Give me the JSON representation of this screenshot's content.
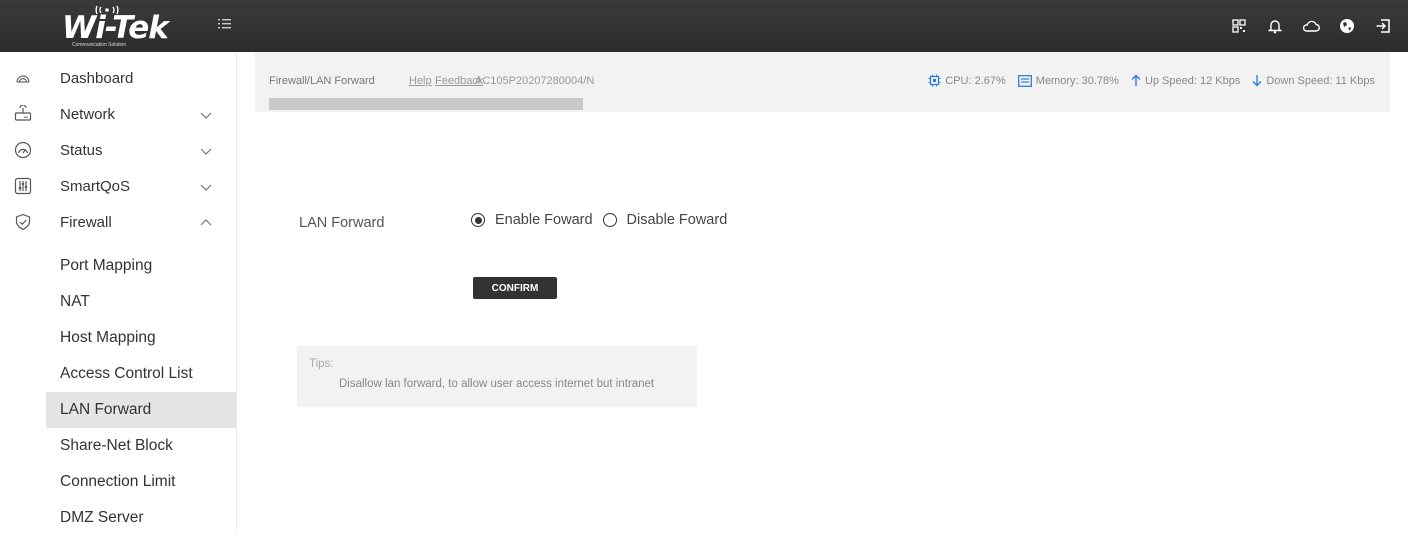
{
  "brand": {
    "logo": "Wi-Tek",
    "tagline": "Communication Solution"
  },
  "topbar": {
    "icons": [
      "qr-code-icon",
      "bell-icon",
      "cloud-icon",
      "globe-icon",
      "logout-icon"
    ]
  },
  "sidebar": {
    "items": [
      {
        "label": "Dashboard",
        "icon": "dashboard-icon"
      },
      {
        "label": "Network",
        "icon": "router-icon",
        "expanded": false
      },
      {
        "label": "Status",
        "icon": "gauge-icon",
        "expanded": false
      },
      {
        "label": "SmartQoS",
        "icon": "sliders-icon",
        "expanded": false
      },
      {
        "label": "Firewall",
        "icon": "shield-icon",
        "expanded": true
      }
    ],
    "firewall_sub": [
      {
        "label": "Port Mapping"
      },
      {
        "label": "NAT"
      },
      {
        "label": "Host Mapping"
      },
      {
        "label": "Access Control List"
      },
      {
        "label": "LAN Forward",
        "active": true
      },
      {
        "label": "Share-Net Block"
      },
      {
        "label": "Connection Limit"
      },
      {
        "label": "DMZ Server"
      }
    ]
  },
  "header": {
    "breadcrumb": "Firewall/LAN Forward",
    "help": "Help",
    "feedback": "Feedback",
    "serial": "AC105P20207280004/N",
    "cpu": "CPU: 2.67%",
    "memory": "Memory: 30.78%",
    "up_speed": "Up Speed: 12 Kbps",
    "down_speed": "Down Speed: 11 Kbps"
  },
  "form": {
    "label": "LAN Forward",
    "enable": "Enable Foward",
    "disable": "Disable Foward",
    "selected": "enable",
    "confirm": "CONFIRM"
  },
  "tips": {
    "title": "Tips:",
    "text": "Disallow lan forward, to allow user access internet but intranet"
  },
  "colors": {
    "topbar": "#2f2f2f",
    "accent_blue": "#2f7fe0",
    "active_bg": "#e5e5e5"
  }
}
